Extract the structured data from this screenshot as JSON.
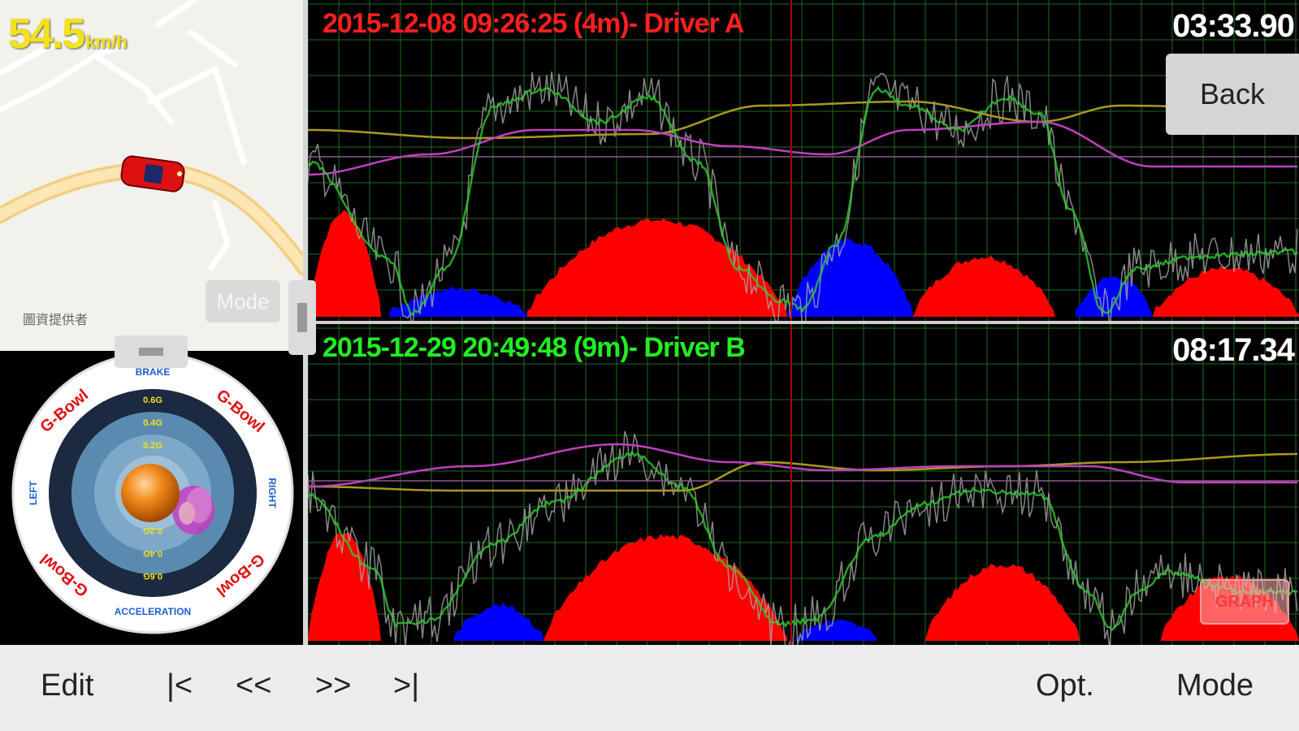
{
  "map": {
    "speed_value": "54.5",
    "speed_unit": "km/h",
    "credit": "圖資提供者",
    "mode_label": "Mode"
  },
  "gbowl": {
    "brand": "G-Bowl",
    "top_label": "BRAKE",
    "bottom_label": "ACCELERATION",
    "left_label": "LEFT",
    "right_label": "RIGHT",
    "ring_values": [
      "0.6G",
      "0.4G",
      "0.2G"
    ]
  },
  "graphs": [
    {
      "label": "2015-12-08 09:26:25 (4m)- Driver A",
      "label_color": "#ff2020",
      "lap_time": "03:33.90"
    },
    {
      "label": "2015-12-29 20:49:48 (9m)- Driver B",
      "label_color": "#22ee22",
      "lap_time": "08:17.34"
    }
  ],
  "buttons": {
    "back": "Back",
    "graph": "GRAPH"
  },
  "toolbar": {
    "edit": "Edit",
    "first": "|<",
    "rewind": "<<",
    "forward": ">>",
    "last": ">|",
    "options": "Opt.",
    "mode": "Mode"
  },
  "colors": {
    "brake_fill": "#ff0000",
    "accel_fill": "#0000ff",
    "speed_line": "#2ecc2e",
    "raw_line": "#a8a8a8",
    "grid": "#1f6a1f",
    "purple_line": "#c040c0",
    "olive_line": "#a89a20",
    "marker": "#aa0000"
  }
}
